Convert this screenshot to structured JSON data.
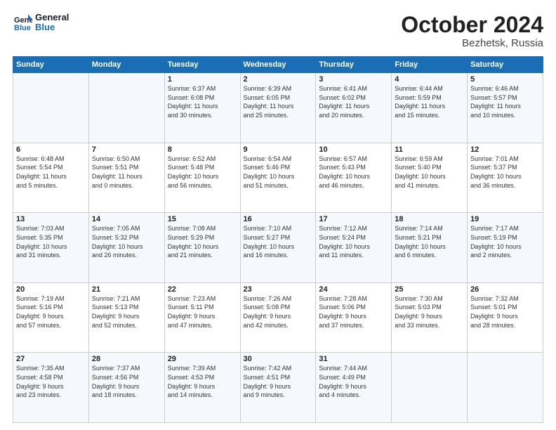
{
  "logo": {
    "line1": "General",
    "line2": "Blue"
  },
  "title": "October 2024",
  "subtitle": "Bezhetsk, Russia",
  "days_header": [
    "Sunday",
    "Monday",
    "Tuesday",
    "Wednesday",
    "Thursday",
    "Friday",
    "Saturday"
  ],
  "weeks": [
    [
      {
        "day": "",
        "info": ""
      },
      {
        "day": "",
        "info": ""
      },
      {
        "day": "1",
        "info": "Sunrise: 6:37 AM\nSunset: 6:08 PM\nDaylight: 11 hours\nand 30 minutes."
      },
      {
        "day": "2",
        "info": "Sunrise: 6:39 AM\nSunset: 6:05 PM\nDaylight: 11 hours\nand 25 minutes."
      },
      {
        "day": "3",
        "info": "Sunrise: 6:41 AM\nSunset: 6:02 PM\nDaylight: 11 hours\nand 20 minutes."
      },
      {
        "day": "4",
        "info": "Sunrise: 6:44 AM\nSunset: 5:59 PM\nDaylight: 11 hours\nand 15 minutes."
      },
      {
        "day": "5",
        "info": "Sunrise: 6:46 AM\nSunset: 5:57 PM\nDaylight: 11 hours\nand 10 minutes."
      }
    ],
    [
      {
        "day": "6",
        "info": "Sunrise: 6:48 AM\nSunset: 5:54 PM\nDaylight: 11 hours\nand 5 minutes."
      },
      {
        "day": "7",
        "info": "Sunrise: 6:50 AM\nSunset: 5:51 PM\nDaylight: 11 hours\nand 0 minutes."
      },
      {
        "day": "8",
        "info": "Sunrise: 6:52 AM\nSunset: 5:48 PM\nDaylight: 10 hours\nand 56 minutes."
      },
      {
        "day": "9",
        "info": "Sunrise: 6:54 AM\nSunset: 5:46 PM\nDaylight: 10 hours\nand 51 minutes."
      },
      {
        "day": "10",
        "info": "Sunrise: 6:57 AM\nSunset: 5:43 PM\nDaylight: 10 hours\nand 46 minutes."
      },
      {
        "day": "11",
        "info": "Sunrise: 6:59 AM\nSunset: 5:40 PM\nDaylight: 10 hours\nand 41 minutes."
      },
      {
        "day": "12",
        "info": "Sunrise: 7:01 AM\nSunset: 5:37 PM\nDaylight: 10 hours\nand 36 minutes."
      }
    ],
    [
      {
        "day": "13",
        "info": "Sunrise: 7:03 AM\nSunset: 5:35 PM\nDaylight: 10 hours\nand 31 minutes."
      },
      {
        "day": "14",
        "info": "Sunrise: 7:05 AM\nSunset: 5:32 PM\nDaylight: 10 hours\nand 26 minutes."
      },
      {
        "day": "15",
        "info": "Sunrise: 7:08 AM\nSunset: 5:29 PM\nDaylight: 10 hours\nand 21 minutes."
      },
      {
        "day": "16",
        "info": "Sunrise: 7:10 AM\nSunset: 5:27 PM\nDaylight: 10 hours\nand 16 minutes."
      },
      {
        "day": "17",
        "info": "Sunrise: 7:12 AM\nSunset: 5:24 PM\nDaylight: 10 hours\nand 11 minutes."
      },
      {
        "day": "18",
        "info": "Sunrise: 7:14 AM\nSunset: 5:21 PM\nDaylight: 10 hours\nand 6 minutes."
      },
      {
        "day": "19",
        "info": "Sunrise: 7:17 AM\nSunset: 5:19 PM\nDaylight: 10 hours\nand 2 minutes."
      }
    ],
    [
      {
        "day": "20",
        "info": "Sunrise: 7:19 AM\nSunset: 5:16 PM\nDaylight: 9 hours\nand 57 minutes."
      },
      {
        "day": "21",
        "info": "Sunrise: 7:21 AM\nSunset: 5:13 PM\nDaylight: 9 hours\nand 52 minutes."
      },
      {
        "day": "22",
        "info": "Sunrise: 7:23 AM\nSunset: 5:11 PM\nDaylight: 9 hours\nand 47 minutes."
      },
      {
        "day": "23",
        "info": "Sunrise: 7:26 AM\nSunset: 5:08 PM\nDaylight: 9 hours\nand 42 minutes."
      },
      {
        "day": "24",
        "info": "Sunrise: 7:28 AM\nSunset: 5:06 PM\nDaylight: 9 hours\nand 37 minutes."
      },
      {
        "day": "25",
        "info": "Sunrise: 7:30 AM\nSunset: 5:03 PM\nDaylight: 9 hours\nand 33 minutes."
      },
      {
        "day": "26",
        "info": "Sunrise: 7:32 AM\nSunset: 5:01 PM\nDaylight: 9 hours\nand 28 minutes."
      }
    ],
    [
      {
        "day": "27",
        "info": "Sunrise: 7:35 AM\nSunset: 4:58 PM\nDaylight: 9 hours\nand 23 minutes."
      },
      {
        "day": "28",
        "info": "Sunrise: 7:37 AM\nSunset: 4:56 PM\nDaylight: 9 hours\nand 18 minutes."
      },
      {
        "day": "29",
        "info": "Sunrise: 7:39 AM\nSunset: 4:53 PM\nDaylight: 9 hours\nand 14 minutes."
      },
      {
        "day": "30",
        "info": "Sunrise: 7:42 AM\nSunset: 4:51 PM\nDaylight: 9 hours\nand 9 minutes."
      },
      {
        "day": "31",
        "info": "Sunrise: 7:44 AM\nSunset: 4:49 PM\nDaylight: 9 hours\nand 4 minutes."
      },
      {
        "day": "",
        "info": ""
      },
      {
        "day": "",
        "info": ""
      }
    ]
  ]
}
